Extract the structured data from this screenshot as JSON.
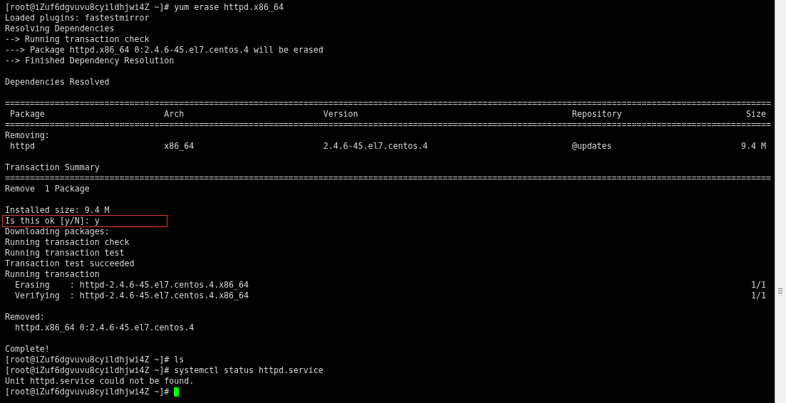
{
  "terminal": {
    "lines": [
      {
        "kind": "text",
        "text": "[root@iZuf6dgvuvu8cyildhjwi4Z ~]# yum erase httpd.x86_64"
      },
      {
        "kind": "text",
        "text": "Loaded plugins: fastestmirror"
      },
      {
        "kind": "text",
        "text": "Resolving Dependencies"
      },
      {
        "kind": "text",
        "text": "--> Running transaction check"
      },
      {
        "kind": "text",
        "text": "---> Package httpd.x86_64 0:2.4.6-45.el7.centos.4 will be erased"
      },
      {
        "kind": "text",
        "text": "--> Finished Dependency Resolution"
      },
      {
        "kind": "blank"
      },
      {
        "kind": "text",
        "text": "Dependencies Resolved"
      },
      {
        "kind": "blank"
      },
      {
        "kind": "text",
        "text": "=========================================================================================================================================================="
      },
      {
        "kind": "header",
        "cells": [
          "Package",
          "Arch",
          "Version",
          "Repository",
          "Size"
        ]
      },
      {
        "kind": "text",
        "text": "=========================================================================================================================================================="
      },
      {
        "kind": "text",
        "text": "Removing:"
      },
      {
        "kind": "row",
        "cells": [
          "httpd",
          "x86_64",
          "2.4.6-45.el7.centos.4",
          "@updates",
          "9.4 M"
        ]
      },
      {
        "kind": "blank"
      },
      {
        "kind": "text",
        "text": "Transaction Summary"
      },
      {
        "kind": "text",
        "text": "=========================================================================================================================================================="
      },
      {
        "kind": "text",
        "text": "Remove  1 Package"
      },
      {
        "kind": "blank"
      },
      {
        "kind": "text",
        "text": "Installed size: 9.4 M"
      },
      {
        "kind": "highlight",
        "text": "Is this ok [y/N]: y"
      },
      {
        "kind": "text",
        "text": "Downloading packages:"
      },
      {
        "kind": "text",
        "text": "Running transaction check"
      },
      {
        "kind": "text",
        "text": "Running transaction test"
      },
      {
        "kind": "text",
        "text": "Transaction test succeeded"
      },
      {
        "kind": "text",
        "text": "Running transaction"
      },
      {
        "kind": "step",
        "text": "  Erasing    : httpd-2.4.6-45.el7.centos.4.x86_64",
        "count": "1/1"
      },
      {
        "kind": "step",
        "text": "  Verifying  : httpd-2.4.6-45.el7.centos.4.x86_64",
        "count": "1/1"
      },
      {
        "kind": "blank"
      },
      {
        "kind": "text",
        "text": "Removed:"
      },
      {
        "kind": "text",
        "text": "  httpd.x86_64 0:2.4.6-45.el7.centos.4"
      },
      {
        "kind": "blank"
      },
      {
        "kind": "text",
        "text": "Complete!"
      },
      {
        "kind": "text",
        "text": "[root@iZuf6dgvuvu8cyildhjwi4Z ~]# ls"
      },
      {
        "kind": "text",
        "text": "[root@iZuf6dgvuvu8cyildhjwi4Z ~]# systemctl status httpd.service"
      },
      {
        "kind": "text",
        "text": "Unit httpd.service could not be found."
      },
      {
        "kind": "prompt",
        "text": "[root@iZuf6dgvuvu8cyildhjwi4Z ~]# "
      }
    ]
  }
}
